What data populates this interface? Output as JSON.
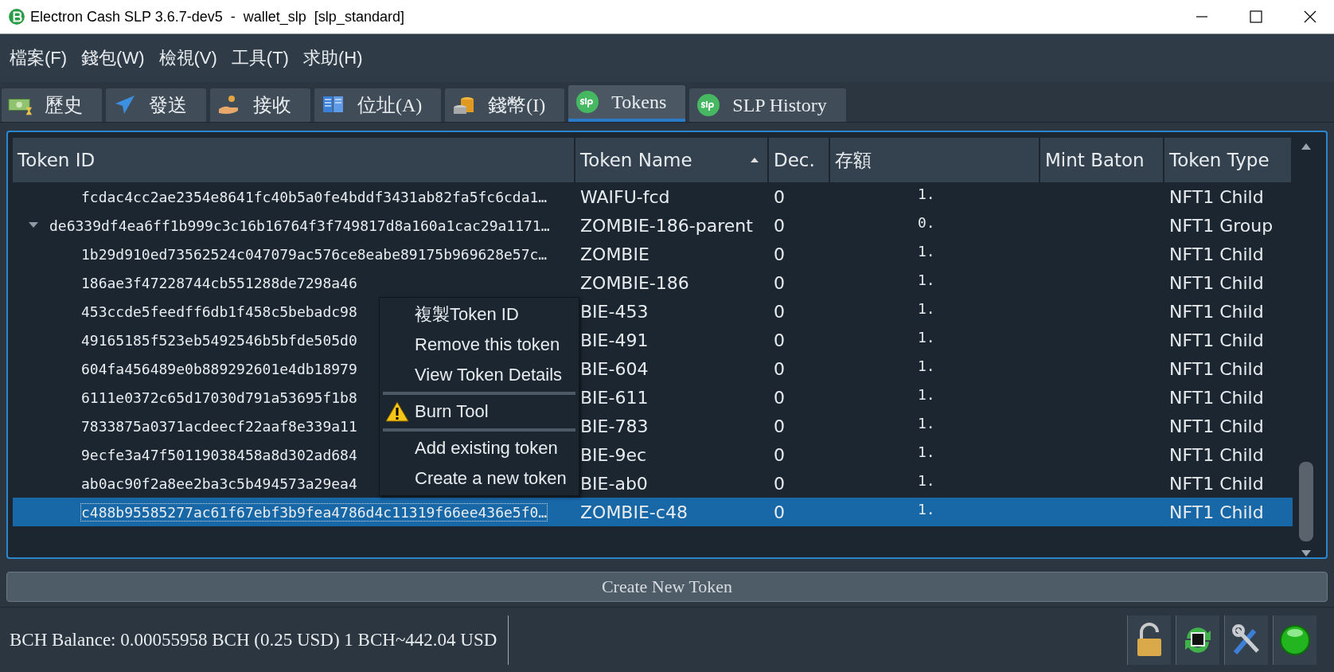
{
  "window": {
    "title": "Electron Cash SLP 3.6.7-dev5  -  wallet_slp  [slp_standard]"
  },
  "menu_bar": [
    "檔案(F)",
    "錢包(W)",
    "檢視(V)",
    "工具(T)",
    "求助(H)"
  ],
  "tabs": [
    {
      "label": "歷史",
      "selected": false
    },
    {
      "label": "發送",
      "selected": false
    },
    {
      "label": "接收",
      "selected": false
    },
    {
      "label": "位址(A)",
      "selected": false
    },
    {
      "label": "錢幣(I)",
      "selected": false
    },
    {
      "label": "Tokens",
      "selected": true
    },
    {
      "label": "SLP History",
      "selected": false
    }
  ],
  "table": {
    "columns": [
      {
        "label": "Token ID",
        "sorted": false
      },
      {
        "label": "Token Name",
        "sorted": true
      },
      {
        "label": "Dec.",
        "sorted": false
      },
      {
        "label": "存額",
        "sorted": false
      },
      {
        "label": "Mint Baton",
        "sorted": false
      },
      {
        "label": "Token Type",
        "sorted": false
      }
    ],
    "rows": [
      {
        "token_id": "fcdac4cc2ae2354e8641fc40b5a0fe4bddf3431ab82fa5fc6cda1…",
        "name": "WAIFU-fcd",
        "dec": "0",
        "balance": "1.",
        "type": "NFT1 Child",
        "selected": false
      },
      {
        "token_id": "de6339df4ea6ff1b999c3c16b16764f3f749817d8a160a1cac29a1171…",
        "name": "ZOMBIE-186-parent",
        "dec": "0",
        "balance": "0.",
        "type": "NFT1 Group",
        "selected": false,
        "expanded": true,
        "children": [
          {
            "token_id": "1b29d910ed73562524c047079ac576ce8eabe89175b969628e57c…",
            "name": "ZOMBIE",
            "dec": "0",
            "balance": "1.",
            "type": "NFT1 Child",
            "selected": false
          },
          {
            "token_id": "186ae3f47228744cb551288de7298a46",
            "name": "ZOMBIE-186",
            "dec": "0",
            "balance": "1.",
            "type": "NFT1 Child",
            "selected": false
          },
          {
            "token_id": "453ccde5feedff6db1f458c5bebadc98",
            "name": "BIE-453",
            "dec": "0",
            "balance": "1.",
            "type": "NFT1 Child",
            "selected": false
          },
          {
            "token_id": "49165185f523eb5492546b5bfde505d0",
            "name": "BIE-491",
            "dec": "0",
            "balance": "1.",
            "type": "NFT1 Child",
            "selected": false
          },
          {
            "token_id": "604fa456489e0b889292601e4db18979",
            "name": "BIE-604",
            "dec": "0",
            "balance": "1.",
            "type": "NFT1 Child",
            "selected": false
          },
          {
            "token_id": "6111e0372c65d17030d791a53695f1b8",
            "name": "BIE-611",
            "dec": "0",
            "balance": "1.",
            "type": "NFT1 Child",
            "selected": false
          },
          {
            "token_id": "7833875a0371acdeecf22aaf8e339a11",
            "name": "BIE-783",
            "dec": "0",
            "balance": "1.",
            "type": "NFT1 Child",
            "selected": false
          },
          {
            "token_id": "9ecfe3a47f50119038458a8d302ad684",
            "name": "BIE-9ec",
            "dec": "0",
            "balance": "1.",
            "type": "NFT1 Child",
            "selected": false
          },
          {
            "token_id": "ab0ac90f2a8ee2ba3c5b494573a29ea4",
            "name": "BIE-ab0",
            "dec": "0",
            "balance": "1.",
            "type": "NFT1 Child",
            "selected": false
          },
          {
            "token_id": "c488b95585277ac61f67ebf3b9fea4786d4c11319f66ee436e5f0…",
            "name": "ZOMBIE-c48",
            "dec": "0",
            "balance": "1.",
            "type": "NFT1 Child",
            "selected": true
          }
        ]
      }
    ]
  },
  "context_menu": [
    {
      "kind": "item",
      "label": "複製Token ID"
    },
    {
      "kind": "item",
      "label": "Remove this token"
    },
    {
      "kind": "item",
      "label": "View Token Details"
    },
    {
      "kind": "separator"
    },
    {
      "kind": "warning",
      "label": "Burn Tool"
    },
    {
      "kind": "separator"
    },
    {
      "kind": "item",
      "label": "Add existing token"
    },
    {
      "kind": "item",
      "label": "Create a new token"
    }
  ],
  "create_button": "Create New Token",
  "status_bar": {
    "balance": "BCH Balance: 0.00055958 BCH (0.25 USD) 1 BCH~442.04 USD"
  }
}
